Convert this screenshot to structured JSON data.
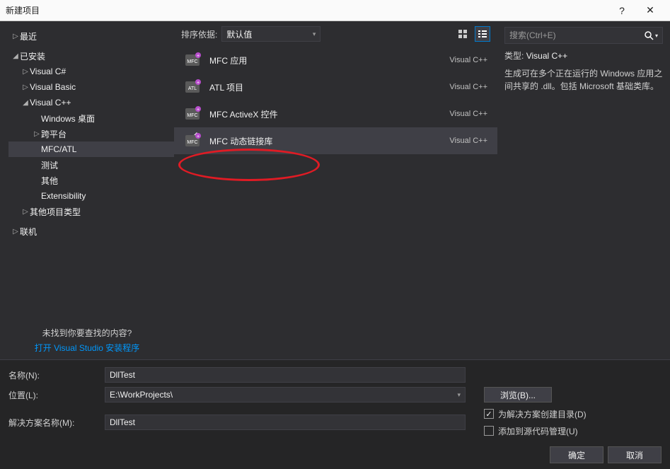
{
  "titlebar": {
    "title": "新建项目",
    "help": "?",
    "close": "✕"
  },
  "sidebar": {
    "recent": {
      "label": "最近"
    },
    "installed": {
      "label": "已安装"
    },
    "nodes": [
      {
        "label": "Visual C#",
        "has_children": true
      },
      {
        "label": "Visual Basic",
        "has_children": true
      },
      {
        "label": "Visual C++",
        "has_children": true,
        "expanded": true,
        "children": [
          {
            "label": "Windows 桌面"
          },
          {
            "label": "跨平台",
            "has_children": true
          },
          {
            "label": "MFC/ATL",
            "selected": true
          },
          {
            "label": "测试"
          },
          {
            "label": "其他"
          },
          {
            "label": "Extensibility"
          }
        ]
      },
      {
        "label": "其他项目类型",
        "has_children": true
      }
    ],
    "online": {
      "label": "联机"
    },
    "not_found_q": "未找到你要查找的内容?",
    "open_installer": "打开 Visual Studio 安装程序"
  },
  "toolbar": {
    "sort_label": "排序依据:",
    "sort_value": "默认值"
  },
  "search": {
    "placeholder": "搜索(Ctrl+E)"
  },
  "templates": [
    {
      "name": "MFC 应用",
      "lang": "Visual C++"
    },
    {
      "name": "ATL 项目",
      "lang": "Visual C++"
    },
    {
      "name": "MFC ActiveX 控件",
      "lang": "Visual C++"
    },
    {
      "name": "MFC 动态链接库",
      "lang": "Visual C++",
      "selected": true
    }
  ],
  "details": {
    "type_label": "类型:",
    "type_value": "Visual C++",
    "description": "生成可在多个正在运行的 Windows 应用之间共享的 .dll。包括 Microsoft 基础类库。"
  },
  "form": {
    "name_label": "名称(N):",
    "name_value": "DllTest",
    "location_label": "位置(L):",
    "location_value": "E:\\WorkProjects\\",
    "browse_label": "浏览(B)...",
    "solution_label": "解决方案名称(M):",
    "solution_value": "DllTest",
    "chk_create_dir": "为解决方案创建目录(D)",
    "chk_add_scm": "添加到源代码管理(U)",
    "ok": "确定",
    "cancel": "取消"
  }
}
